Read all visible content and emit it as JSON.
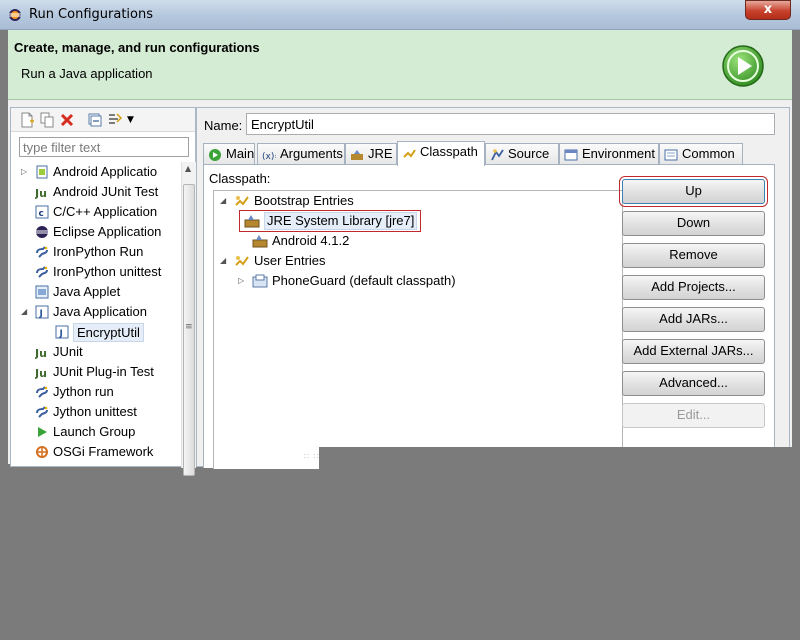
{
  "window": {
    "title": "Run Configurations",
    "close_glyph": "x"
  },
  "banner": {
    "title": "Create, manage, and run configurations",
    "subtitle": "Run a Java application",
    "icon": "run-icon"
  },
  "left": {
    "filter_placeholder": "type filter text",
    "toolbar_icons": [
      "new-configuration-icon",
      "duplicate-icon",
      "delete-icon",
      "collapse-all-icon",
      "filter-icon",
      "view-menu-icon"
    ],
    "tree": [
      {
        "label": "Android Applicatio",
        "icon": "android-app-icon",
        "expander": "collapsed"
      },
      {
        "label": "Android JUnit Test",
        "icon": "junit-icon"
      },
      {
        "label": "C/C++ Application",
        "icon": "c-app-icon"
      },
      {
        "label": "Eclipse Application",
        "icon": "eclipse-icon"
      },
      {
        "label": "IronPython Run",
        "icon": "python-icon"
      },
      {
        "label": "IronPython unittest",
        "icon": "python-icon"
      },
      {
        "label": "Java Applet",
        "icon": "applet-icon"
      },
      {
        "label": "Java Application",
        "icon": "java-app-icon",
        "expander": "expanded"
      },
      {
        "label": "EncryptUtil",
        "icon": "java-app-icon",
        "selected": true
      },
      {
        "label": "JUnit",
        "icon": "junit-icon"
      },
      {
        "label": "JUnit Plug-in Test",
        "icon": "junit-icon"
      },
      {
        "label": "Jython run",
        "icon": "python-icon"
      },
      {
        "label": "Jython unittest",
        "icon": "python-icon"
      },
      {
        "label": "Launch Group",
        "icon": "launch-group-icon"
      },
      {
        "label": "OSGi Framework",
        "icon": "osgi-icon"
      }
    ]
  },
  "right": {
    "name_label": "Name:",
    "name_value": "EncryptUtil",
    "tabs": [
      {
        "label": "Main",
        "icon": "main-tab-icon"
      },
      {
        "label": "Arguments",
        "icon": "arguments-icon"
      },
      {
        "label": "JRE",
        "icon": "jre-icon"
      },
      {
        "label": "Classpath",
        "icon": "classpath-icon",
        "active": true
      },
      {
        "label": "Source",
        "icon": "source-icon"
      },
      {
        "label": "Environment",
        "icon": "environment-icon"
      },
      {
        "label": "Common",
        "icon": "common-icon"
      }
    ],
    "classpath_label": "Classpath:",
    "classpath_tree": [
      {
        "label": "Bootstrap Entries",
        "icon": "entries-icon",
        "expander": "expanded"
      },
      {
        "label": "JRE System Library [jre7]",
        "icon": "library-icon",
        "highlighted": true
      },
      {
        "label": "Android 4.1.2",
        "icon": "library-icon"
      },
      {
        "label": "User Entries",
        "icon": "entries-icon",
        "expander": "expanded"
      },
      {
        "label": "PhoneGuard (default classpath)",
        "icon": "project-icon",
        "expander": "collapsed"
      }
    ],
    "buttons": [
      {
        "label": "Up",
        "state": "focused"
      },
      {
        "label": "Down"
      },
      {
        "label": "Remove"
      },
      {
        "label": "Add Projects..."
      },
      {
        "label": "Add JARs..."
      },
      {
        "label": "Add External JARs..."
      },
      {
        "label": "Advanced..."
      },
      {
        "label": "Edit...",
        "state": "disabled"
      }
    ]
  },
  "colors": {
    "banner_bg": "#d5ecd4",
    "selection_bg": "#e5eef8",
    "highlight_outline": "#c0282d",
    "background_gray": "#7b7b7b"
  }
}
